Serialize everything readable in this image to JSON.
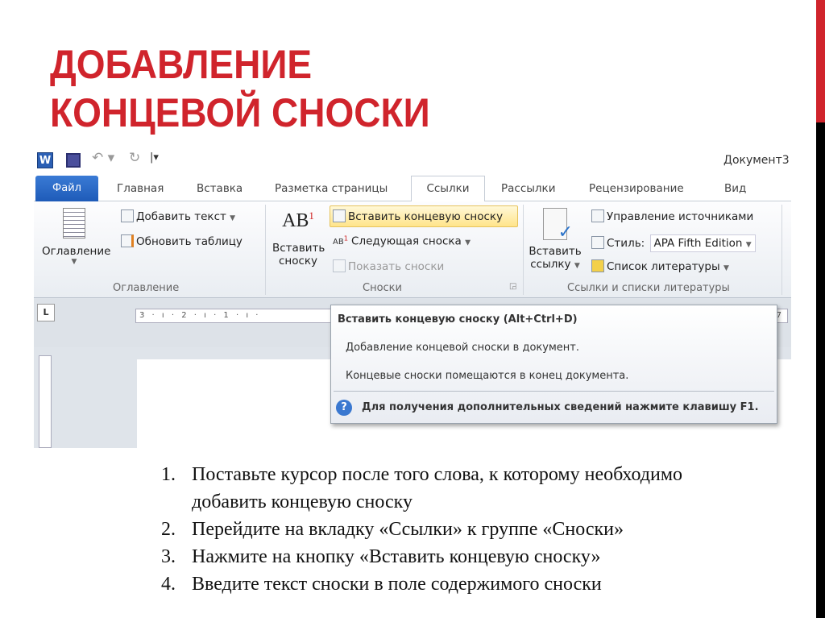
{
  "slide": {
    "title_line1": "ДОБАВЛЕНИЕ",
    "title_line2": "КОНЦЕВОЙ СНОСКИ",
    "accent": "#d0242c"
  },
  "word": {
    "window_title": "Документ3",
    "tabs": [
      "Файл",
      "Главная",
      "Вставка",
      "Разметка страницы",
      "Ссылки",
      "Рассылки",
      "Рецензирование",
      "Вид"
    ],
    "active_tab": "Ссылки",
    "groups": {
      "toc": {
        "big_button": "Оглавление",
        "add_text": "Добавить текст",
        "update_table": "Обновить таблицу",
        "label": "Оглавление"
      },
      "footnotes": {
        "insert_footnote_l1": "Вставить",
        "insert_footnote_l2": "сноску",
        "big_icon": "AB",
        "insert_endnote": "Вставить концевую сноску",
        "next_footnote": "Следующая сноска",
        "show_notes": "Показать сноски",
        "label": "Сноски"
      },
      "citations": {
        "insert_citation_l1": "Вставить",
        "insert_citation_l2": "ссылку",
        "manage_sources": "Управление источниками",
        "style_label": "Стиль:",
        "style_value": "APA Fifth Edition",
        "bibliography": "Список литературы",
        "label": "Ссылки и списки литературы"
      }
    },
    "ruler": {
      "corner": "L",
      "marks": "3 · ı · 2 · ı · 1 · ı ·",
      "end": "7"
    },
    "tooltip": {
      "title": "Вставить концевую сноску (Alt+Ctrl+D)",
      "line1": "Добавление концевой сноски в документ.",
      "line2": "Концевые сноски помещаются в конец документа.",
      "help": "Для получения дополнительных сведений нажмите клавишу F1."
    }
  },
  "steps": [
    {
      "n": "1.",
      "text": "Поставьте курсор после того слова, к которому необходимо добавить концевую сноску"
    },
    {
      "n": "2.",
      "text": "Перейдите на вкладку «Ссылки» к группе «Сноски»"
    },
    {
      "n": "3.",
      "text": "Нажмите на кнопку «Вставить концевую сноску»"
    },
    {
      "n": "4.",
      "text": "Введите текст сноски в поле содержимого сноски"
    }
  ]
}
